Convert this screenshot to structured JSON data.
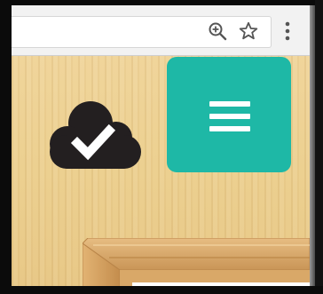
{
  "browser": {
    "address_bar": {
      "value": ""
    },
    "icons": {
      "zoom": "zoom-magnifier-plus-icon",
      "bookmark": "bookmark-star-icon",
      "menu": "kebab-menu-icon"
    }
  },
  "page": {
    "status_icon": "cloud-check-icon",
    "menu_button": {
      "icon": "hamburger-menu-icon"
    }
  },
  "colors": {
    "menu_button": "#1eb8a6",
    "cloud": "#231f20",
    "wood": "#ecd090",
    "frame_wood": "#d9a868"
  }
}
